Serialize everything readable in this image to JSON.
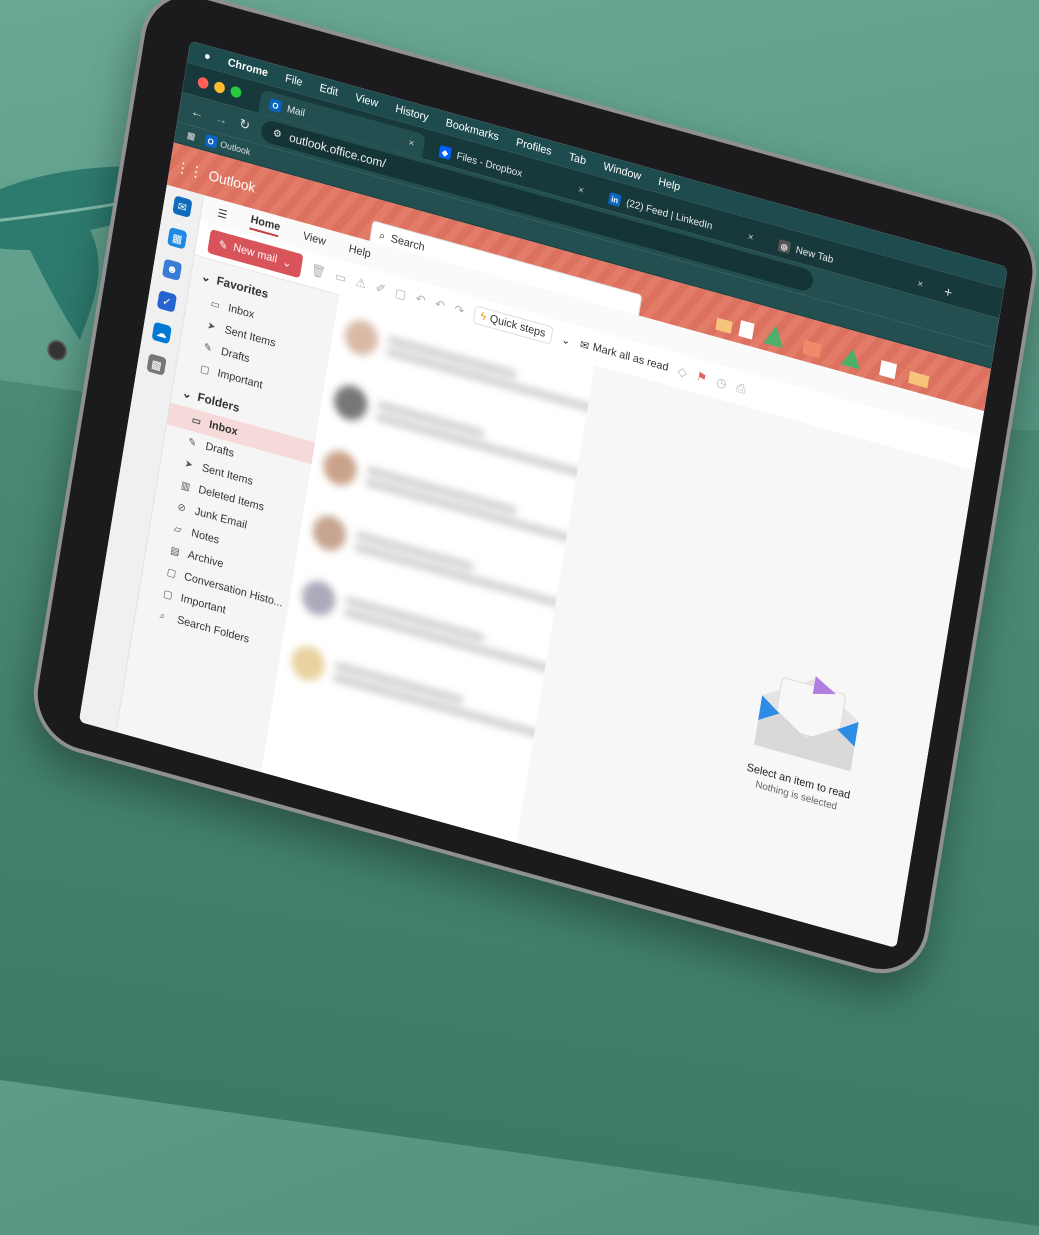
{
  "menubar": {
    "apple": "",
    "app": "Chrome",
    "items": [
      "File",
      "Edit",
      "View",
      "History",
      "Bookmarks",
      "Profiles",
      "Tab",
      "Window",
      "Help"
    ]
  },
  "tabs": [
    {
      "label": "Mail",
      "close": "×"
    },
    {
      "label": "Files - Dropbox",
      "close": "×"
    },
    {
      "label": "(22) Feed | LinkedIn",
      "close": "×"
    },
    {
      "label": "New Tab",
      "close": "×"
    }
  ],
  "new_tab": "+",
  "address": {
    "url": "outlook.office.com/"
  },
  "bookmarks": {
    "item": "Outlook"
  },
  "outlook": {
    "brand": "Outlook",
    "search_placeholder": "Search",
    "ribbon_tabs": [
      "Home",
      "View",
      "Help"
    ],
    "new_mail": "New mail",
    "quick_steps": "Quick steps",
    "mark_all_read": "Mark all as read",
    "favorites": {
      "title": "Favorites",
      "items": [
        "Inbox",
        "Sent Items",
        "Drafts",
        "Important"
      ]
    },
    "folders": {
      "title": "Folders",
      "items": [
        "Inbox",
        "Drafts",
        "Sent Items",
        "Deleted Items",
        "Junk Email",
        "Notes",
        "Archive",
        "Conversation Histo...",
        "Important",
        "Search Folders"
      ]
    },
    "reading": {
      "title": "Select an item to read",
      "subtitle": "Nothing is selected"
    }
  },
  "colors": {
    "accent": "#d9535a",
    "chrome_bg": "#17393b",
    "header": "#e27b68"
  }
}
